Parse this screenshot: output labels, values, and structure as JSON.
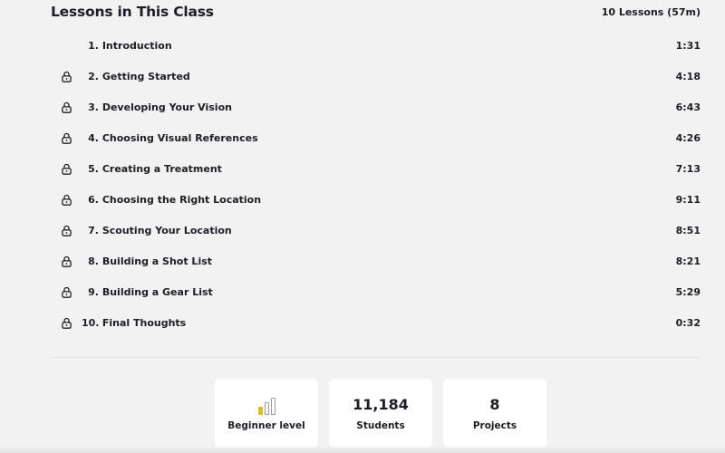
{
  "header": {
    "title": "Lessons in This Class",
    "lesson_count": "10 Lessons (57m)"
  },
  "lessons": [
    {
      "number": "1.",
      "title": "Introduction",
      "duration": "1:31",
      "locked": false
    },
    {
      "number": "2.",
      "title": "Getting Started",
      "duration": "4:18",
      "locked": true
    },
    {
      "number": "3.",
      "title": "Developing Your Vision",
      "duration": "6:43",
      "locked": true
    },
    {
      "number": "4.",
      "title": "Choosing Visual References",
      "duration": "4:26",
      "locked": true
    },
    {
      "number": "5.",
      "title": "Creating a Treatment",
      "duration": "7:13",
      "locked": true
    },
    {
      "number": "6.",
      "title": "Choosing the Right Location",
      "duration": "9:11",
      "locked": true
    },
    {
      "number": "7.",
      "title": "Scouting Your Location",
      "duration": "8:51",
      "locked": true
    },
    {
      "number": "8.",
      "title": "Building a Shot List",
      "duration": "8:21",
      "locked": true
    },
    {
      "number": "9.",
      "title": "Building a Gear List",
      "duration": "5:29",
      "locked": true
    },
    {
      "number": "10.",
      "title": "Final Thoughts",
      "duration": "0:32",
      "locked": true
    }
  ],
  "stats": {
    "level": {
      "label": "Beginner level",
      "icon": "level-bars-icon",
      "filled_bars": 1,
      "total_bars": 3
    },
    "students": {
      "value": "11,184",
      "label": "Students"
    },
    "projects": {
      "value": "8",
      "label": "Projects"
    }
  },
  "colors": {
    "background": "#f2f2f2",
    "card": "#ffffff",
    "text": "#1d1d26",
    "level_active": "#e0c000",
    "level_inactive": "#9a9a9a"
  }
}
